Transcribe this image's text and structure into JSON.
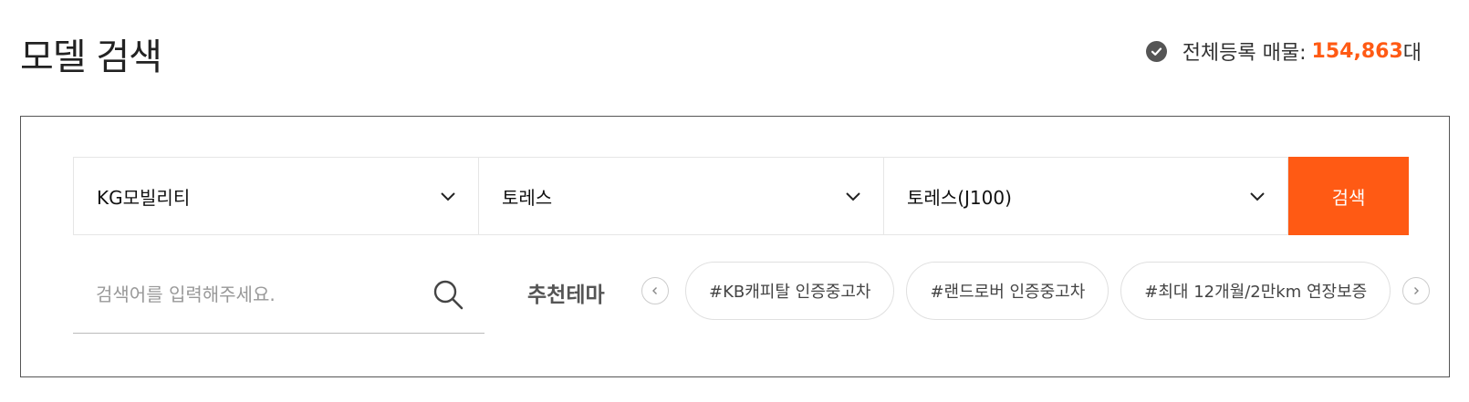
{
  "header": {
    "title": "모델 검색",
    "total_label": "전체등록 매물:",
    "total_count": "154,863",
    "total_unit": "대"
  },
  "filters": {
    "maker": "KG모빌리티",
    "model": "토레스",
    "detail_model": "토레스(J100)",
    "search_button": "검색"
  },
  "keyword": {
    "placeholder": "검색어를 입력해주세요.",
    "value": ""
  },
  "themes": {
    "label": "추천테마",
    "chips": [
      "#KB캐피탈 인증중고차",
      "#랜드로버 인증중고차",
      "#최대 12개월/2만km 연장보증"
    ]
  },
  "colors": {
    "accent": "#ff5a14",
    "border": "#555555"
  }
}
